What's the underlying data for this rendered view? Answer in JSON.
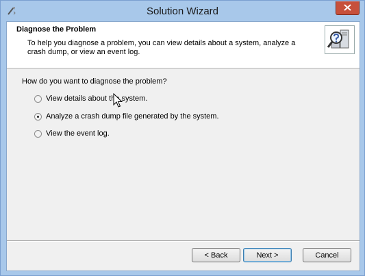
{
  "window": {
    "title": "Solution Wizard"
  },
  "header": {
    "title": "Diagnose the Problem",
    "description": "To help you diagnose a problem, you can view details about a system, analyze a crash dump, or view an event log."
  },
  "body": {
    "question": "How do you want to diagnose the problem?",
    "options": [
      {
        "label": "View details about the system.",
        "checked": false
      },
      {
        "label": "Analyze a crash dump file generated by the system.",
        "checked": true
      },
      {
        "label": "View the event log.",
        "checked": false
      }
    ]
  },
  "footer": {
    "back_label": "< Back",
    "next_label": "Next >",
    "cancel_label": "Cancel"
  },
  "icons": {
    "app": "wizard-app-icon",
    "header": "computer-magnifier-icon",
    "close": "close-icon",
    "cursor": "mouse-pointer-icon"
  },
  "colors": {
    "titlebar": "#a8c8ea",
    "close_button": "#c7503b",
    "dialog_background": "#f0f0f0",
    "default_button_border": "#3c7fb1"
  }
}
